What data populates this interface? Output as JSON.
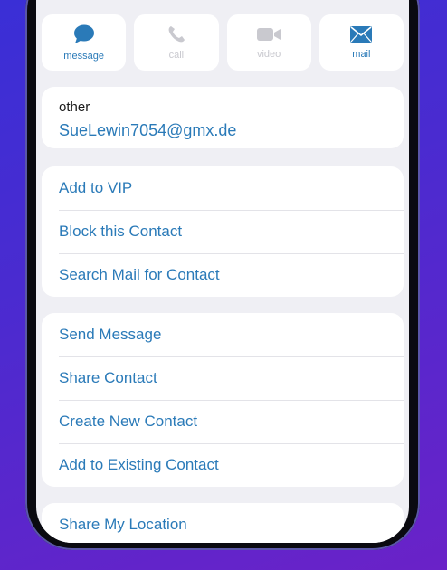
{
  "actions": [
    {
      "label": "message",
      "icon": "message-bubble-icon",
      "enabled": true
    },
    {
      "label": "call",
      "icon": "phone-icon",
      "enabled": false
    },
    {
      "label": "video",
      "icon": "video-camera-icon",
      "enabled": false
    },
    {
      "label": "mail",
      "icon": "envelope-icon",
      "enabled": true
    }
  ],
  "email": {
    "type_label": "other",
    "address": "SueLewin7054@gmx.de"
  },
  "group_vip": {
    "add_vip": "Add to VIP",
    "block": "Block this Contact",
    "search_mail": "Search Mail for Contact"
  },
  "group_share": {
    "send_message": "Send Message",
    "share_contact": "Share Contact",
    "create_new": "Create New Contact",
    "add_existing": "Add to Existing Contact"
  },
  "group_location": {
    "share_location": "Share My Location"
  },
  "colors": {
    "accent": "#2a7ab8",
    "disabled": "#c9c9cf",
    "background": "#efeff4"
  }
}
